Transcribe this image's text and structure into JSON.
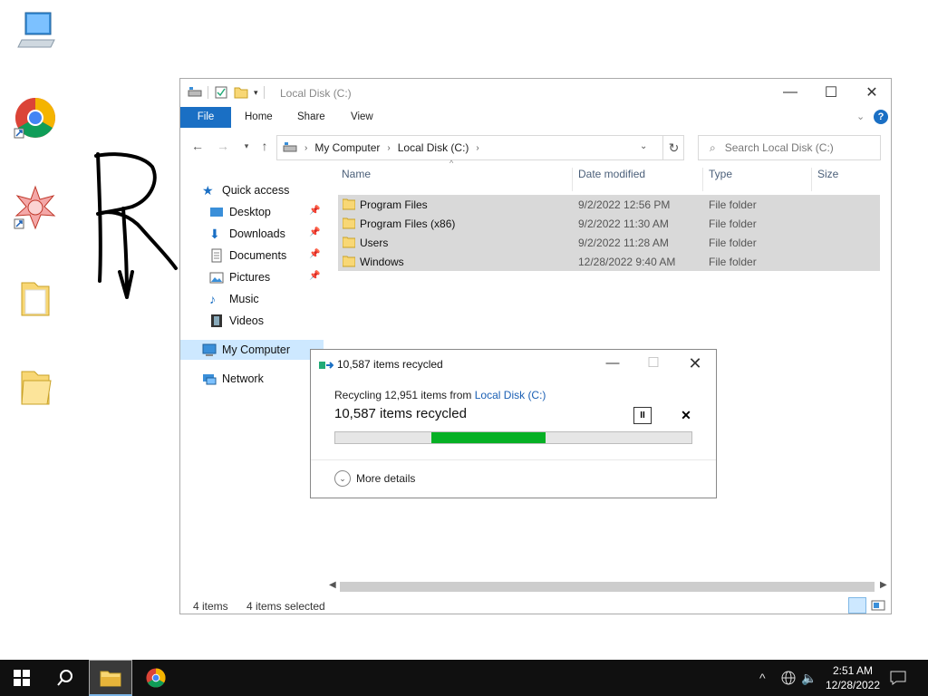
{
  "explorer": {
    "title": "Local Disk (C:)",
    "ribbon_tabs": [
      "File",
      "Home",
      "Share",
      "View"
    ],
    "address": {
      "segments": [
        "My Computer",
        "Local Disk (C:)"
      ]
    },
    "search_placeholder": "Search Local Disk (C:)",
    "nav": {
      "quick_access": "Quick access",
      "items": [
        {
          "label": "Desktop",
          "pinned": true
        },
        {
          "label": "Downloads",
          "pinned": true
        },
        {
          "label": "Documents",
          "pinned": true
        },
        {
          "label": "Pictures",
          "pinned": true
        },
        {
          "label": "Music",
          "pinned": false
        },
        {
          "label": "Videos",
          "pinned": false
        }
      ],
      "my_computer": "My Computer",
      "network": "Network"
    },
    "columns": {
      "name": "Name",
      "date": "Date modified",
      "type": "Type",
      "size": "Size"
    },
    "rows": [
      {
        "name": "Program Files",
        "date": "9/2/2022 12:56 PM",
        "type": "File folder"
      },
      {
        "name": "Program Files (x86)",
        "date": "9/2/2022 11:30 AM",
        "type": "File folder"
      },
      {
        "name": "Users",
        "date": "9/2/2022 11:28 AM",
        "type": "File folder"
      },
      {
        "name": "Windows",
        "date": "12/28/2022 9:40 AM",
        "type": "File folder"
      }
    ],
    "status": {
      "count": "4 items",
      "selected": "4 items selected"
    }
  },
  "dialog": {
    "title": "10,587 items recycled",
    "from_prefix": "Recycling 12,951 items from",
    "from_link": "Local Disk (C:)",
    "headline": "10,587 items recycled",
    "progress_start_fraction": 0.27,
    "progress_end_fraction": 0.59,
    "pause_label": "II",
    "cancel_label": "✕",
    "more_details": "More details"
  },
  "taskbar": {
    "time": "2:51 AM",
    "date": "12/28/2022"
  },
  "colors": {
    "accent": "#1a6fc4",
    "progress": "#06b025",
    "selection": "#d9d9d9",
    "nav_selected": "#cde8ff",
    "taskbar": "#101010"
  }
}
